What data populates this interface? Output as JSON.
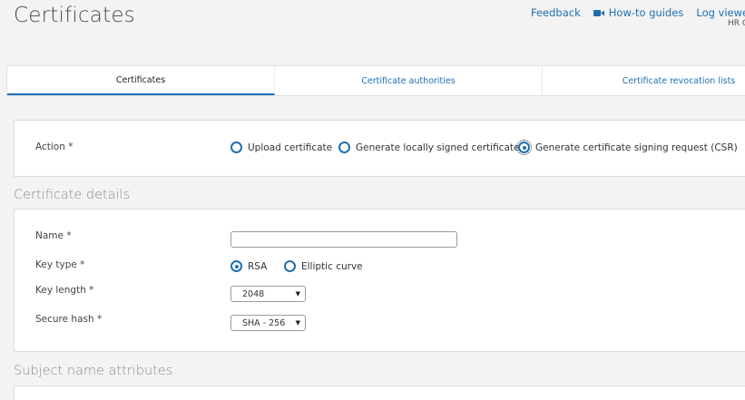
{
  "header": {
    "title": "Certificates",
    "links": {
      "feedback": "Feedback",
      "howto": "How-to guides",
      "logviewer": "Log viewer",
      "help_partial": "H"
    },
    "user_partial": "HR C"
  },
  "tabs": [
    {
      "label": "Certificates",
      "active": true
    },
    {
      "label": "Certificate authorities",
      "active": false
    },
    {
      "label": "Certificate revocation lists",
      "active": false
    }
  ],
  "action": {
    "label": "Action *",
    "options": [
      {
        "label": "Upload certificate",
        "checked": false
      },
      {
        "label": "Generate locally signed certificate",
        "checked": false
      },
      {
        "label": "Generate certificate signing request (CSR)",
        "checked": true
      }
    ]
  },
  "details": {
    "title": "Certificate details",
    "name": {
      "label": "Name *",
      "value": ""
    },
    "key_type": {
      "label": "Key type *",
      "options": [
        {
          "label": "RSA",
          "checked": true
        },
        {
          "label": "Elliptic curve",
          "checked": false
        }
      ]
    },
    "key_length": {
      "label": "Key length *",
      "value": "2048"
    },
    "secure_hash": {
      "label": "Secure hash *",
      "value": "SHA - 256"
    }
  },
  "subject": {
    "title": "Subject name attributes"
  },
  "colors": {
    "accent": "#1f6fb0",
    "background": "#f3f3f3",
    "panel": "#ffffff"
  },
  "icons": {
    "howto": "video-camera-icon",
    "caret": "caret-down-icon"
  }
}
